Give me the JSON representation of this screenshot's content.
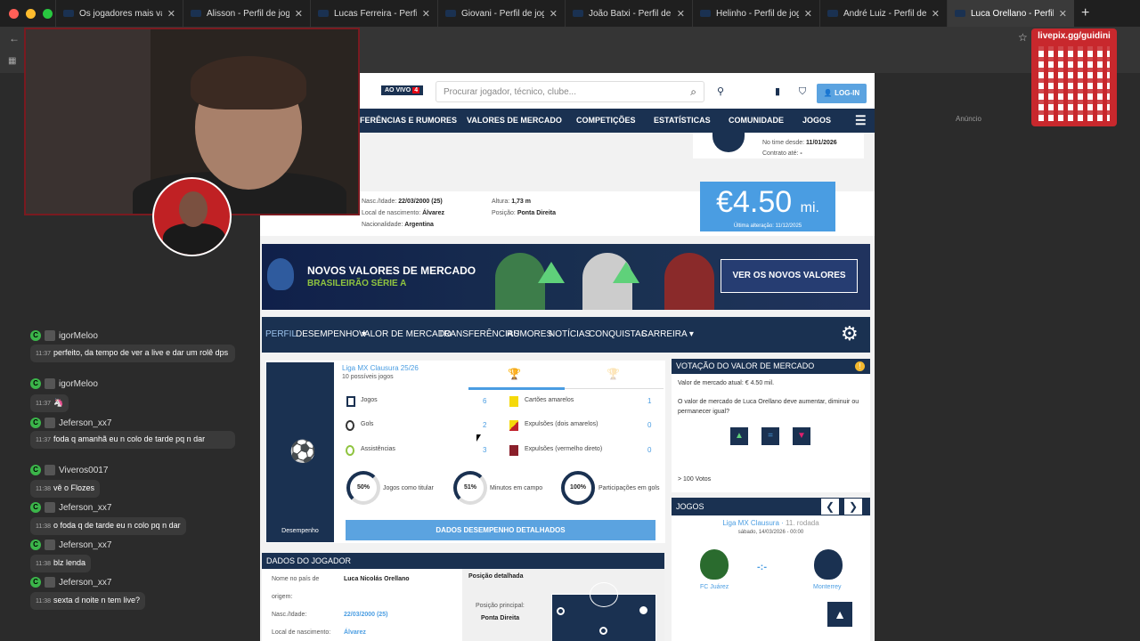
{
  "browser": {
    "tabs": [
      {
        "label": "Os jogadores mais valios"
      },
      {
        "label": "Alisson - Perfil de jogado"
      },
      {
        "label": "Lucas Ferreira - Perfil de"
      },
      {
        "label": "Giovani - Perfil de jogado"
      },
      {
        "label": "João Batxi - Perfil de joga"
      },
      {
        "label": "Helinho - Perfil de jogado"
      },
      {
        "label": "André Luiz - Perfil de joga"
      },
      {
        "label": "Luca Orellano - Perfil de j"
      }
    ],
    "anuncio": "Anúncio"
  },
  "overlay": {
    "livepix": "livepix.gg/guidini"
  },
  "header": {
    "aovivo": "AO VIVO",
    "aovivo_count": "4",
    "search_placeholder": "Procurar jogador, técnico, clube...",
    "login": "LOG-IN"
  },
  "nav": [
    "FERÊNCIAS E RUMORES",
    "VALORES DE MERCADO",
    "COMPETIÇÕES",
    "ESTATÍSTICAS",
    "COMUNIDADE",
    "JOGOS"
  ],
  "club": {
    "since_label": "No time desde:",
    "since": "11/01/2026",
    "contract_label": "Contrato até:",
    "contract": "-"
  },
  "player": {
    "birth_label": "Nasc./Idade:",
    "birth": "22/03/2000 (25)",
    "place_label": "Local de nascimento:",
    "place": "Álvarez",
    "nat_label": "Nacionalidade:",
    "nat": "Argentina",
    "height_label": "Altura:",
    "height": "1,73 m",
    "pos_label": "Posição:",
    "pos": "Ponta Direita",
    "value": "€4.50",
    "value_unit": "mi.",
    "value_date": "Última alteração: 11/12/2025"
  },
  "banner": {
    "line1": "NOVOS VALORES DE MERCADO",
    "line2": "BRASILEIRÃO SÉRIE A",
    "button": "VER OS NOVOS VALORES"
  },
  "subnav": [
    "PERFIL",
    "DESEMPENHO ▾",
    "VALOR DE MERCADO",
    "TRANSFERÊNCIAS",
    "RUMORES",
    "NOTÍCIAS",
    "CONQUISTAS",
    "CARREIRA ▾"
  ],
  "performance": {
    "side_label": "Desempenho",
    "league": "Liga MX Clausura 25/26",
    "possible": "10 possíveis jogos",
    "stats": [
      {
        "label": "Jogos",
        "value": "6"
      },
      {
        "label": "Gols",
        "value": "2"
      },
      {
        "label": "Assistências",
        "value": "3"
      },
      {
        "label": "Cartões amarelos",
        "value": "1"
      },
      {
        "label": "Expulsões (dois amarelos)",
        "value": "0"
      },
      {
        "label": "Expulsões (vermelho direto)",
        "value": "0"
      }
    ],
    "rings": [
      {
        "pct": "50%",
        "label": "Jogos como titular"
      },
      {
        "pct": "51%",
        "label": "Minutos em campo"
      },
      {
        "pct": "100%",
        "label": "Participações em gols"
      }
    ],
    "button": "DADOS DESEMPENHO DETALHADOS"
  },
  "dados": {
    "title": "DADOS DO JOGADOR",
    "name_label": "Nome no país de",
    "name_label2": "origem:",
    "name": "Luca Nicolás Orellano",
    "birth_label": "Nasc./Idade:",
    "birth": "22/03/2000 (25)",
    "place_label": "Local de nascimento:",
    "place": "Álvarez",
    "pos_title": "Posição detalhada",
    "pos_main_label": "Posição principal:",
    "pos_main": "Ponta Direita"
  },
  "vote": {
    "title": "VOTAÇÃO DO VALOR DE MERCADO",
    "current": "Valor de mercado atual: € 4.50 mil.",
    "question": "O valor de mercado de Luca Orellano deve aumentar, diminuir ou permanecer igual?",
    "votes": "> 100 Votos"
  },
  "games": {
    "title": "JOGOS",
    "league": "Liga MX Clausura",
    "round": "11. rodada",
    "date": "sábado, 14/03/2026 - 00:00",
    "home": "FC Juárez",
    "away": "Monterrey",
    "score": "-:-"
  },
  "chat": [
    {
      "user": "igorMeloo",
      "time": "11:37",
      "msg": "perfeito, da tempo de ver a live e dar um rolê dps"
    },
    {
      "user": "igorMeloo",
      "time": "11:37",
      "msg": "🦄"
    },
    {
      "user": "Jeferson_xx7",
      "time": "11:37",
      "msg": "foda q amanhã eu n colo de tarde pq n dar"
    },
    {
      "user": "Viveros0017",
      "time": "11:38",
      "msg": "vê o Flozes"
    },
    {
      "user": "Jeferson_xx7",
      "time": "11:38",
      "msg": "o foda q de tarde eu n colo pq n dar"
    },
    {
      "user": "Jeferson_xx7",
      "time": "11:38",
      "msg": "blz lenda"
    },
    {
      "user": "Jeferson_xx7",
      "time": "11:38",
      "msg": "sexta d noite n tem live?"
    }
  ],
  "colors": {
    "navy": "#1a3151",
    "accent": "#4a9de2",
    "live_red": "#e30613",
    "livepix": "#c8282d"
  }
}
